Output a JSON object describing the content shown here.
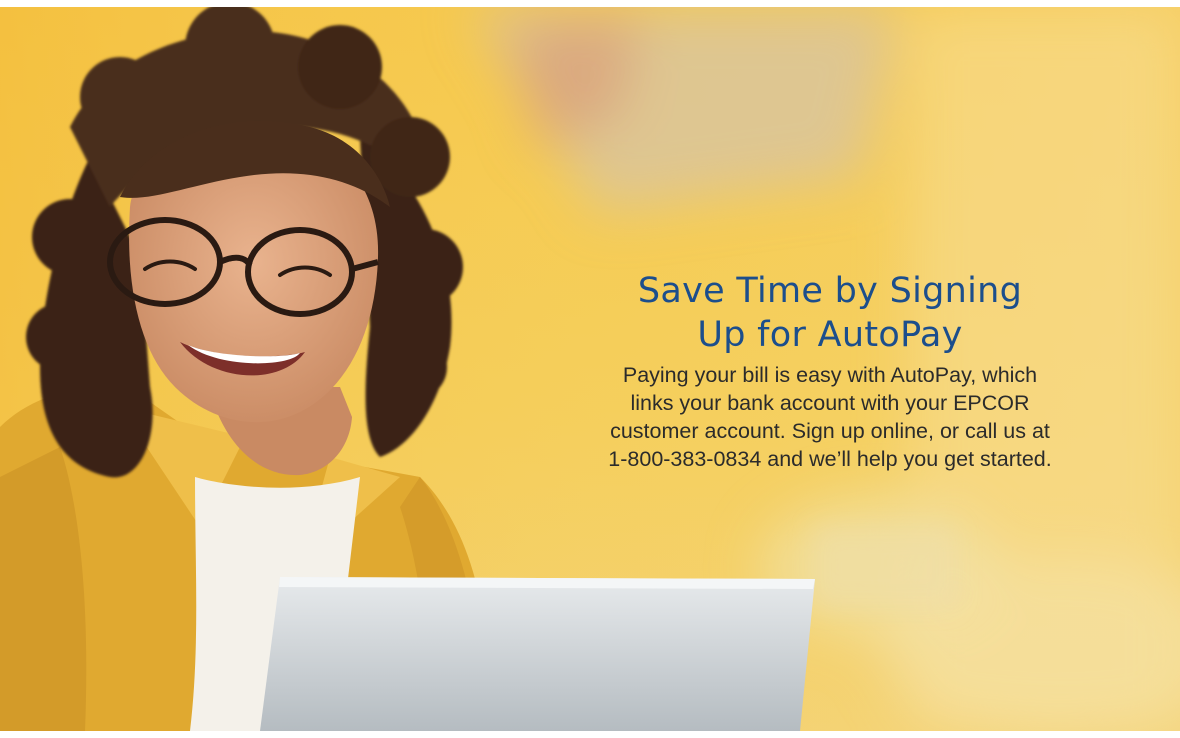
{
  "banner": {
    "headline_lines": [
      "Save Time by Signing",
      "Up for AutoPay"
    ],
    "body_lines": [
      "Paying your bill is easy with AutoPay, which",
      "links your bank account with your EPCOR",
      "customer account. Sign up online, or call us at",
      "1-800-383-0834 and we’ll help you get started."
    ]
  },
  "colors": {
    "headline": "#1c4e8c",
    "body_text": "#2b2b2b",
    "background_yellow": "#f6c94d",
    "jacket_mustard": "#e0a930",
    "laptop_silver": "#c4c9cd"
  },
  "photo": {
    "subject": "smiling young woman with curly hair and glasses using a laptop"
  }
}
